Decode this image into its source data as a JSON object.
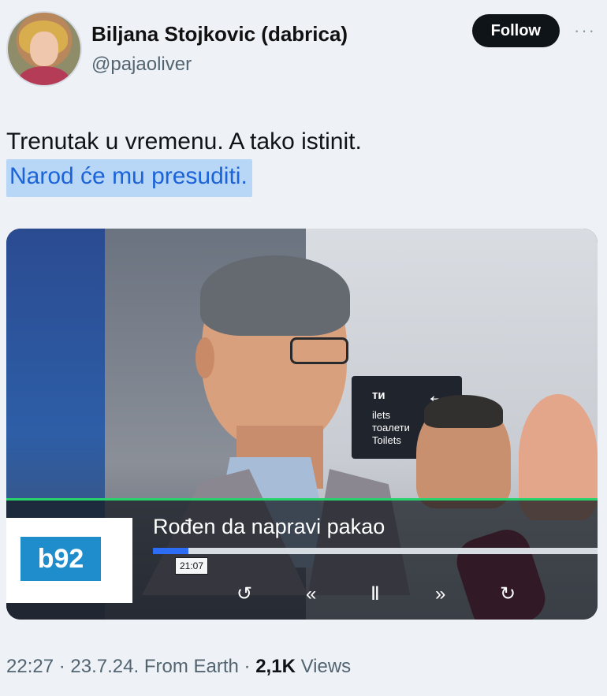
{
  "header": {
    "display_name": "Biljana Stojkovic (dabrica)",
    "handle": "@pajaoliver",
    "follow_label": "Follow",
    "more_label": "···"
  },
  "tweet": {
    "line1": "Trenutak u vremenu. A tako istinit.",
    "line2": "Narod će mu presuditi."
  },
  "media": {
    "channel_logo": "b92",
    "headline": "Rođen da napravi pakao",
    "timestamp": "21:07",
    "progress": 0.08,
    "signage": {
      "line1": "ти",
      "line2": "ilets",
      "line3": "тоалети",
      "line4": "Toilets"
    },
    "controls": {
      "replay": "↺",
      "rewind": "«",
      "pause": "Ⅱ",
      "forward": "»",
      "refresh": "↻"
    }
  },
  "footer": {
    "time": "22:27",
    "date": "23.7.24.",
    "source": "From Earth",
    "views_count": "2,1K",
    "views_label": "Views"
  }
}
